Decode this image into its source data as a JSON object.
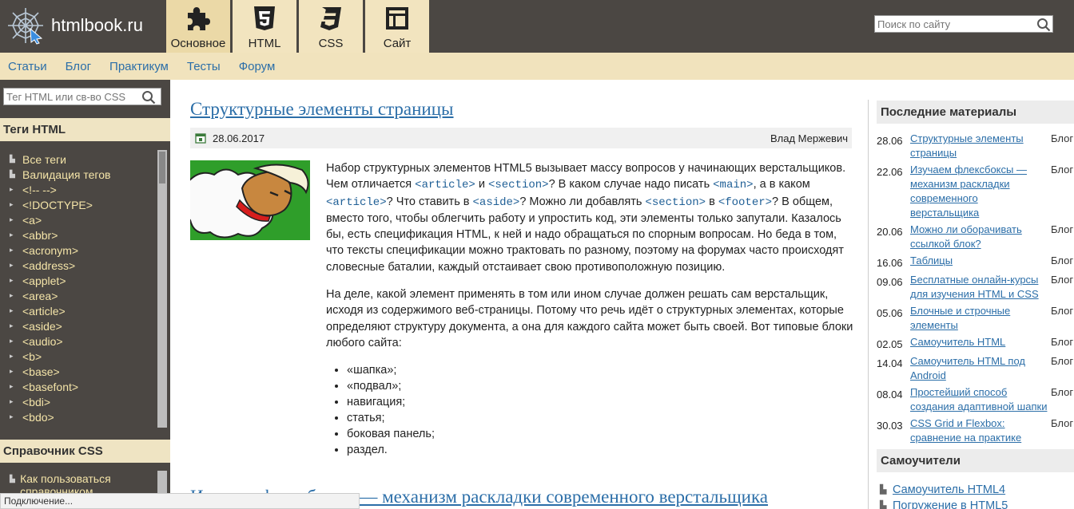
{
  "header": {
    "site_name": "htmlbook.ru",
    "tabs": [
      {
        "label": "Основное",
        "icon": "puzzle-icon",
        "active": true
      },
      {
        "label": "HTML",
        "icon": "html5-icon",
        "active": false
      },
      {
        "label": "CSS",
        "icon": "css3-icon",
        "active": false
      },
      {
        "label": "Сайт",
        "icon": "site-layout-icon",
        "active": false
      }
    ],
    "search_placeholder": "Поиск по сайту"
  },
  "nav": {
    "items": [
      "Статьи",
      "Блог",
      "Практикум",
      "Тесты",
      "Форум"
    ]
  },
  "left": {
    "search_placeholder": "Тег HTML или св-во CSS",
    "html_tags_title": "Теги HTML",
    "html_tags": [
      "Все теги",
      "Валидация тегов",
      "<!-- -->",
      "<!DOCTYPE>",
      "<a>",
      "<abbr>",
      "<acronym>",
      "<address>",
      "<applet>",
      "<area>",
      "<article>",
      "<aside>",
      "<audio>",
      "<b>",
      "<base>",
      "<basefont>",
      "<bdi>",
      "<bdo>"
    ],
    "css_ref_title": "Справочник CSS",
    "css_items": [
      "Как пользоваться справочником"
    ]
  },
  "article": {
    "title": "Структурные элементы страницы",
    "date": "28.06.2017",
    "author": "Влад Мержевич",
    "p1": {
      "a": "Набор структурных элементов HTML5 вызывает массу вопросов у начинающих верстальщиков. Чем отличается ",
      "c1": "<article>",
      "b": " и ",
      "c2": "<section>",
      "c": "? В каком случае надо писать ",
      "c3": "<main>",
      "d": ", а в каком ",
      "c4": "<article>",
      "e": "? Что ставить в ",
      "c5": "<aside>",
      "f": "? Можно ли добавлять ",
      "c6": "<section>",
      "g": " в ",
      "c7": "<footer>",
      "h": "? В общем, вместо того, чтобы облегчить работу и упростить код, эти элементы только запутали. Казалось бы, есть спецификация HTML, к ней и надо обращаться по спорным вопросам. Но беда в том, что тексты спецификации можно трактовать по разному, поэтому на форумах часто происходят словесные баталии, каждый отстаивает свою противоположную позицию."
    },
    "p2": "На деле, какой элемент применять в том или ином случае должен решать сам верстальщик, исходя из содержимого веб-страницы. Потому что речь идёт о структурных элементах, которые определяют структуру документа, а она для каждого сайта может быть своей. Вот типовые блоки любого сайта:",
    "list": [
      "«шапка»;",
      "«подвал»;",
      "навигация;",
      "статья;",
      "боковая панель;",
      "раздел."
    ],
    "next_title": "Изучаем флексбоксы — механизм раскладки современного верстальщика"
  },
  "right": {
    "recent_title": "Последние материалы",
    "recent": [
      {
        "date": "28.06",
        "title": "Структурные элементы страницы",
        "cat": "Блог"
      },
      {
        "date": "22.06",
        "title": "Изучаем флексбоксы — механизм раскладки современного верстальщика",
        "cat": "Блог"
      },
      {
        "date": "20.06",
        "title": "Можно ли оборачивать ссылкой блок?",
        "cat": "Блог"
      },
      {
        "date": "16.06",
        "title": "Таблицы",
        "cat": "Блог"
      },
      {
        "date": "09.06",
        "title": "Бесплатные онлайн-курсы для изучения HTML и CSS",
        "cat": "Блог"
      },
      {
        "date": "05.06",
        "title": "Блочные и строчные элементы",
        "cat": "Блог"
      },
      {
        "date": "02.05",
        "title": "Самоучитель HTML",
        "cat": "Блог"
      },
      {
        "date": "14.04",
        "title": "Самоучитель HTML под Android",
        "cat": "Блог"
      },
      {
        "date": "08.04",
        "title": "Простейший способ создания адаптивной шапки",
        "cat": "Блог"
      },
      {
        "date": "30.03",
        "title": "CSS Grid и Flexbox: сравнение на практике",
        "cat": "Блог"
      }
    ],
    "tutorials_title": "Самоучители",
    "tutorials": [
      "Самоучитель HTML4",
      "Погружение в HTML5"
    ]
  },
  "status": "Подключение..."
}
